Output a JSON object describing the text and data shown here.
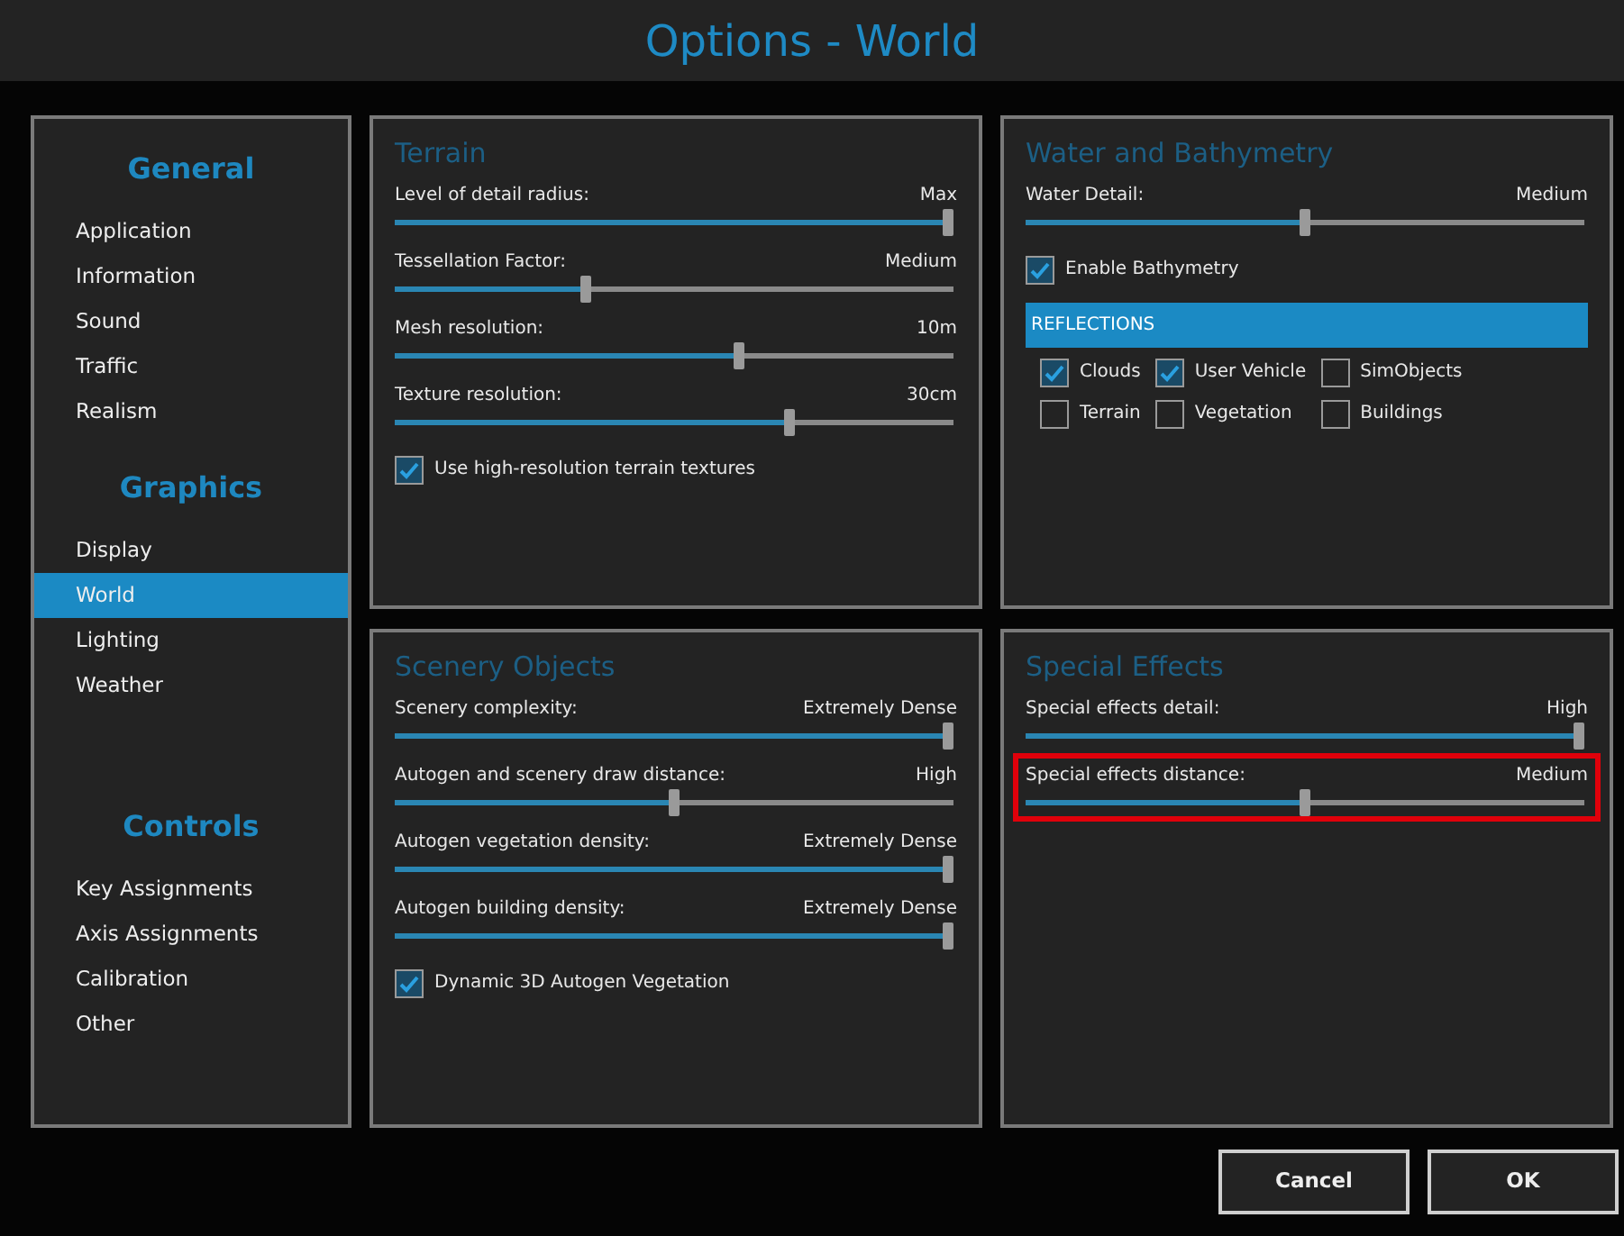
{
  "window": {
    "title": "Options - World"
  },
  "sidebar": {
    "groups": [
      {
        "heading": "General",
        "items": [
          {
            "label": "Application",
            "selected": false
          },
          {
            "label": "Information",
            "selected": false
          },
          {
            "label": "Sound",
            "selected": false
          },
          {
            "label": "Traffic",
            "selected": false
          },
          {
            "label": "Realism",
            "selected": false
          }
        ]
      },
      {
        "heading": "Graphics",
        "items": [
          {
            "label": "Display",
            "selected": false
          },
          {
            "label": "World",
            "selected": true
          },
          {
            "label": "Lighting",
            "selected": false
          },
          {
            "label": "Weather",
            "selected": false
          }
        ]
      },
      {
        "heading": "Controls",
        "items": [
          {
            "label": "Key Assignments",
            "selected": false
          },
          {
            "label": "Axis Assignments",
            "selected": false
          },
          {
            "label": "Calibration",
            "selected": false
          },
          {
            "label": "Other",
            "selected": false
          }
        ]
      }
    ]
  },
  "panels": [
    {
      "title": "Terrain",
      "items": [
        {
          "kind": "slider",
          "label": "Level of detail radius:",
          "reading": "Max",
          "level": 1,
          "highlighted": false
        },
        {
          "kind": "slider",
          "label": "Tessellation Factor:",
          "reading": "Medium",
          "level": 0.34,
          "highlighted": false
        },
        {
          "kind": "slider",
          "label": "Mesh resolution:",
          "reading": "10m",
          "level": 0.62,
          "highlighted": false
        },
        {
          "kind": "slider",
          "label": "Texture resolution:",
          "reading": "30cm",
          "level": 0.71,
          "highlighted": false
        },
        {
          "kind": "checkbox",
          "label": "Use high-resolution terrain textures",
          "checked": true
        }
      ]
    },
    {
      "title": "Water and Bathymetry",
      "items": [
        {
          "kind": "slider",
          "label": "Water Detail:",
          "reading": "Medium",
          "level": 0.5,
          "highlighted": false
        },
        {
          "kind": "checkbox",
          "label": "Enable Bathymetry",
          "checked": true
        },
        {
          "kind": "section",
          "label": "REFLECTIONS"
        },
        {
          "kind": "checkgrid",
          "options": [
            {
              "label": "Clouds",
              "checked": true
            },
            {
              "label": "User Vehicle",
              "checked": true
            },
            {
              "label": "SimObjects",
              "checked": false
            },
            {
              "label": "Terrain",
              "checked": false
            },
            {
              "label": "Vegetation",
              "checked": false
            },
            {
              "label": "Buildings",
              "checked": false
            }
          ]
        }
      ]
    },
    {
      "title": "Scenery Objects",
      "items": [
        {
          "kind": "slider",
          "label": "Scenery complexity:",
          "reading": "Extremely Dense",
          "level": 1,
          "highlighted": false
        },
        {
          "kind": "slider",
          "label": "Autogen and scenery draw distance:",
          "reading": "High",
          "level": 0.5,
          "highlighted": false
        },
        {
          "kind": "slider",
          "label": "Autogen vegetation density:",
          "reading": "Extremely Dense",
          "level": 1,
          "highlighted": false
        },
        {
          "kind": "slider",
          "label": "Autogen building density:",
          "reading": "Extremely Dense",
          "level": 1,
          "highlighted": false
        },
        {
          "kind": "checkbox",
          "label": "Dynamic 3D Autogen Vegetation",
          "checked": true
        }
      ]
    },
    {
      "title": "Special Effects",
      "items": [
        {
          "kind": "slider",
          "label": "Special effects detail:",
          "reading": "High",
          "level": 1,
          "highlighted": false
        },
        {
          "kind": "slider",
          "label": "Special effects distance:",
          "reading": "Medium",
          "level": 0.5,
          "highlighted": true
        }
      ]
    }
  ],
  "buttons": [
    {
      "label": "Cancel"
    },
    {
      "label": "OK"
    }
  ]
}
